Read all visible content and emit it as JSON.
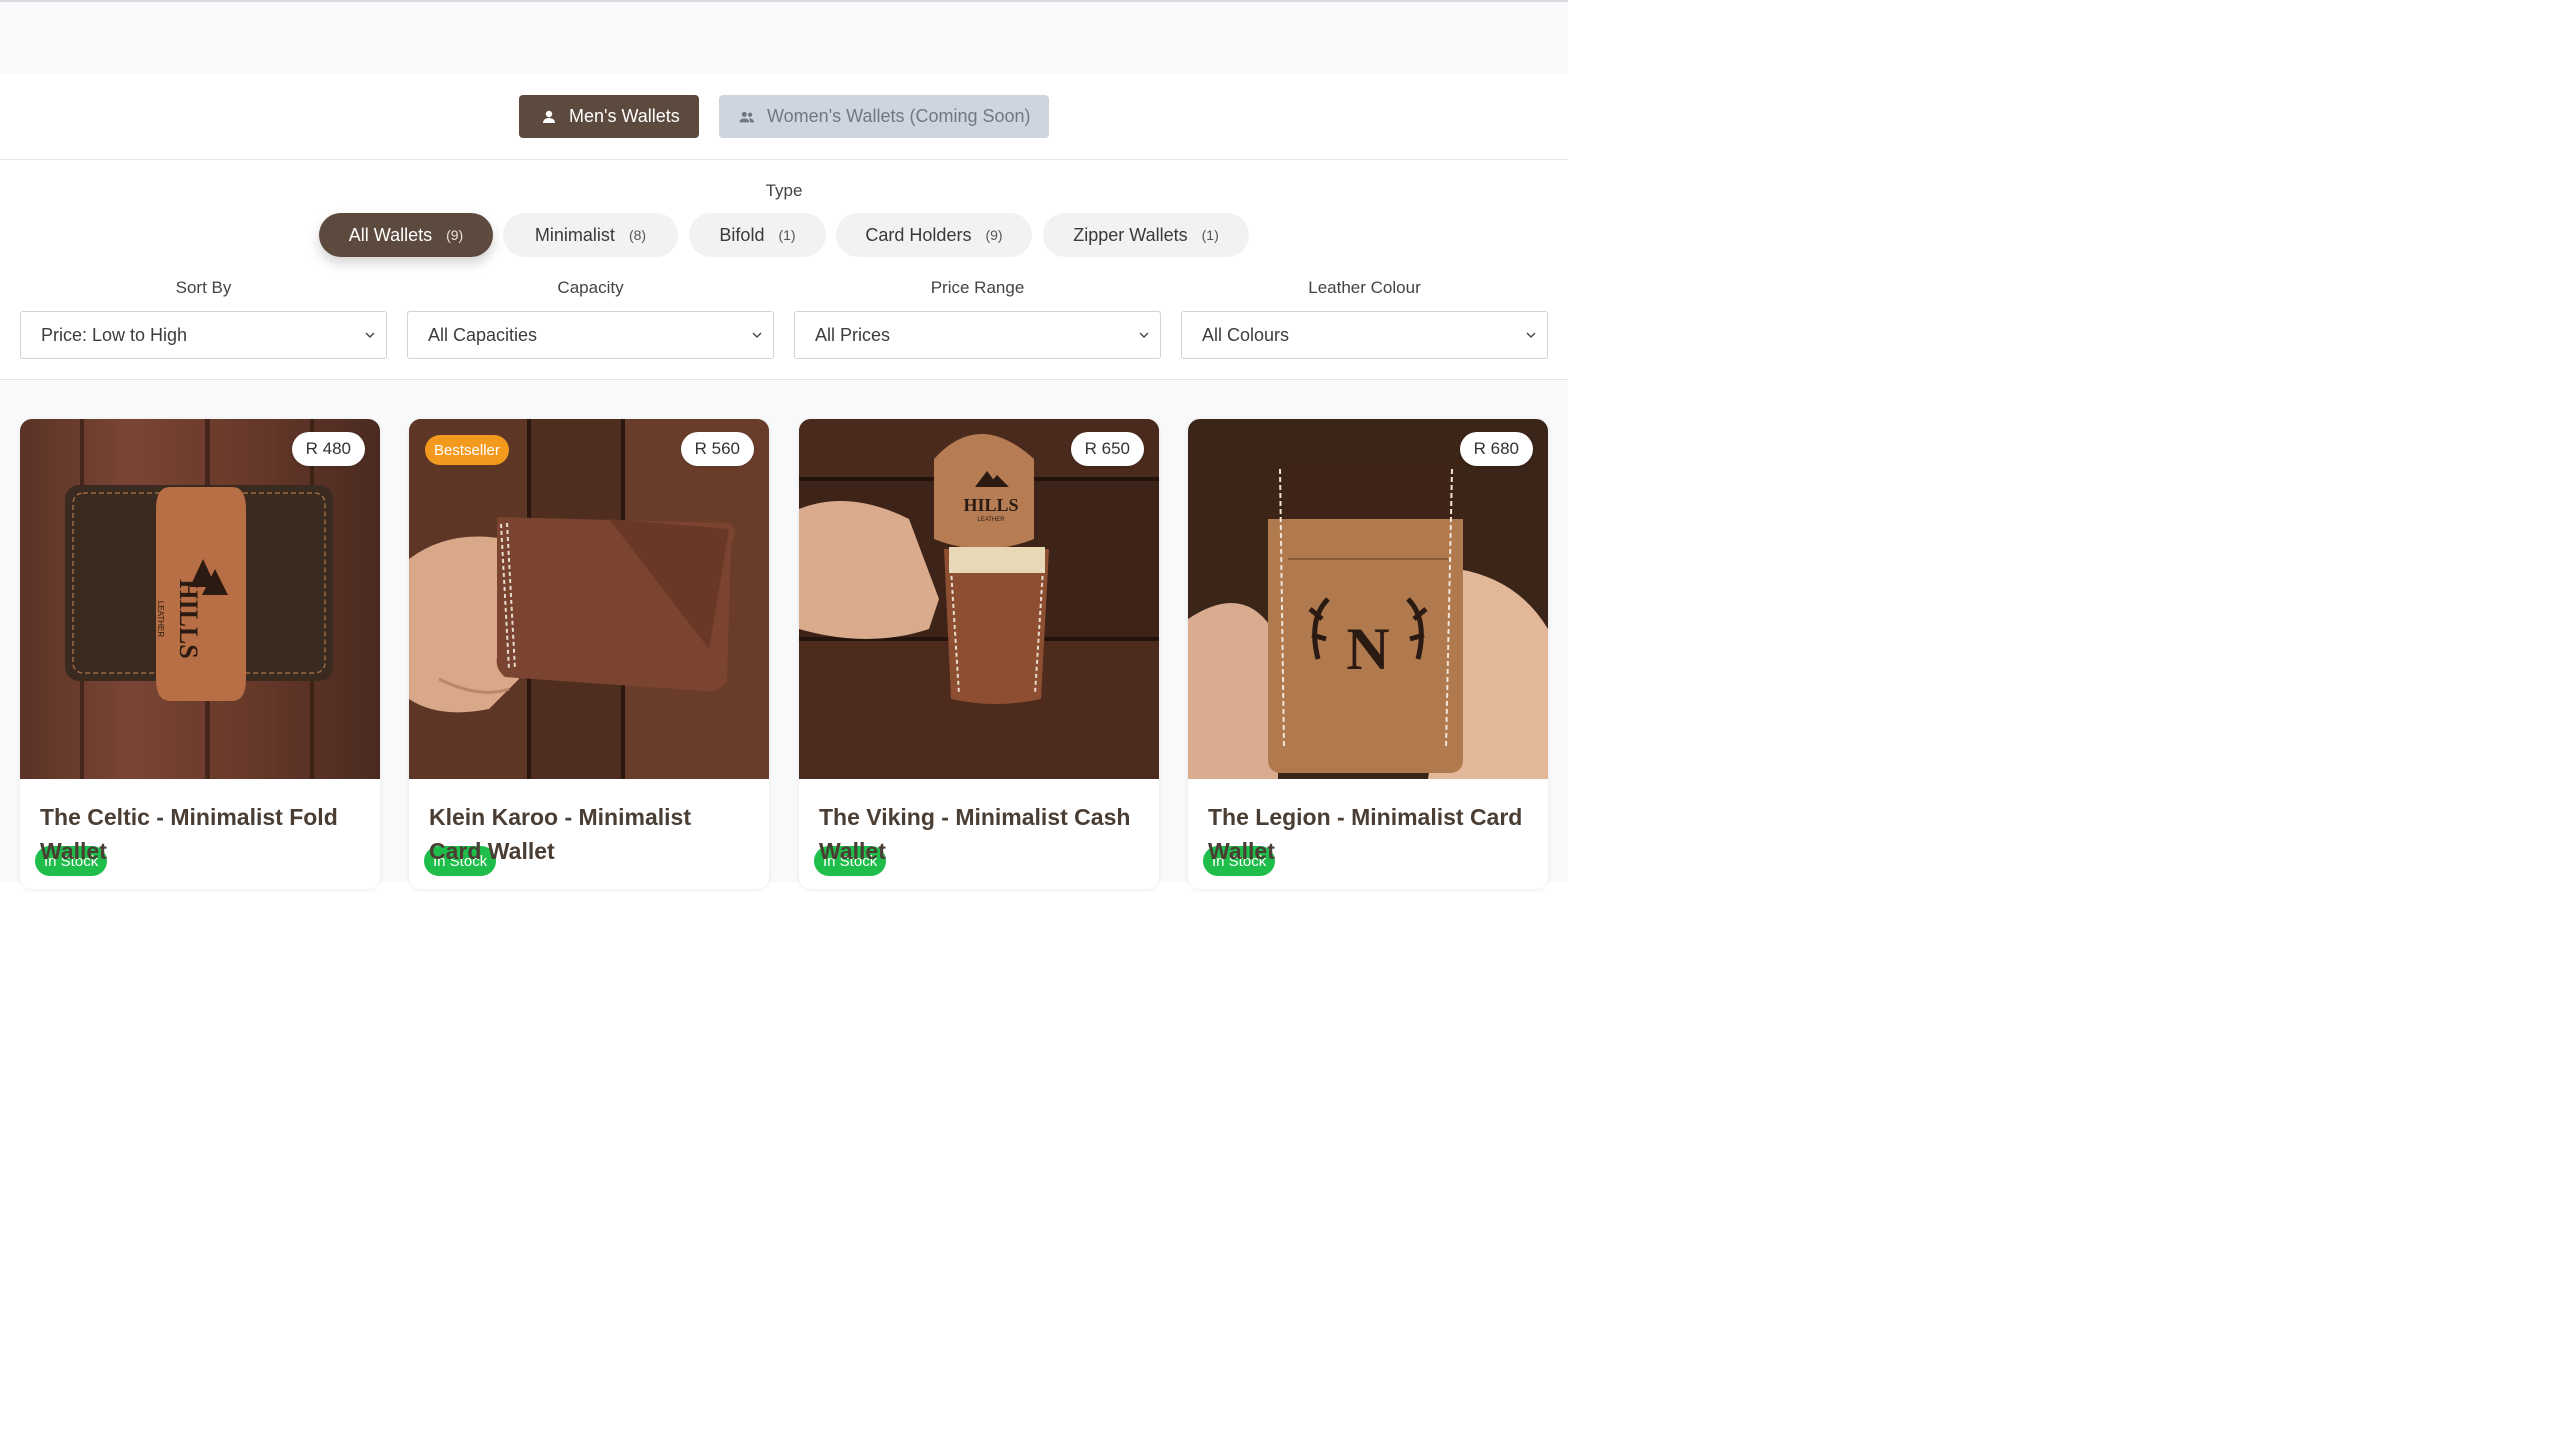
{
  "gender_tabs": {
    "men": "Men's Wallets",
    "women": "Women's Wallets (Coming Soon)"
  },
  "type_filter": {
    "label": "Type",
    "chips": [
      {
        "label": "All Wallets",
        "count": "(9)"
      },
      {
        "label": "Minimalist",
        "count": "(8)"
      },
      {
        "label": "Bifold",
        "count": "(1)"
      },
      {
        "label": "Card Holders",
        "count": "(9)"
      },
      {
        "label": "Zipper Wallets",
        "count": "(1)"
      }
    ]
  },
  "selects": [
    {
      "label": "Sort By",
      "value": "Price: Low to High"
    },
    {
      "label": "Capacity",
      "value": "All Capacities"
    },
    {
      "label": "Price Range",
      "value": "All Prices"
    },
    {
      "label": "Leather Colour",
      "value": "All Colours"
    }
  ],
  "products": [
    {
      "title": "The Celtic - Minimalist Fold Wallet",
      "price": "R 480",
      "stock": "In Stock",
      "badge": ""
    },
    {
      "title": "Klein Karoo - Minimalist Card Wallet",
      "price": "R 560",
      "stock": "In Stock",
      "badge": "Bestseller"
    },
    {
      "title": "The Viking - Minimalist Cash Wallet",
      "price": "R 650",
      "stock": "In Stock",
      "badge": ""
    },
    {
      "title": "The Legion - Minimalist Card Wallet",
      "price": "R 680",
      "stock": "In Stock",
      "badge": ""
    }
  ],
  "photo_text": {
    "hills_brand": "HILLS",
    "leather_word": "LEATHER",
    "monogram": "N"
  },
  "colors": {
    "accent": "#5d4a3e",
    "in_stock": "#1fbd4a",
    "bestseller": "#f39a1e"
  }
}
